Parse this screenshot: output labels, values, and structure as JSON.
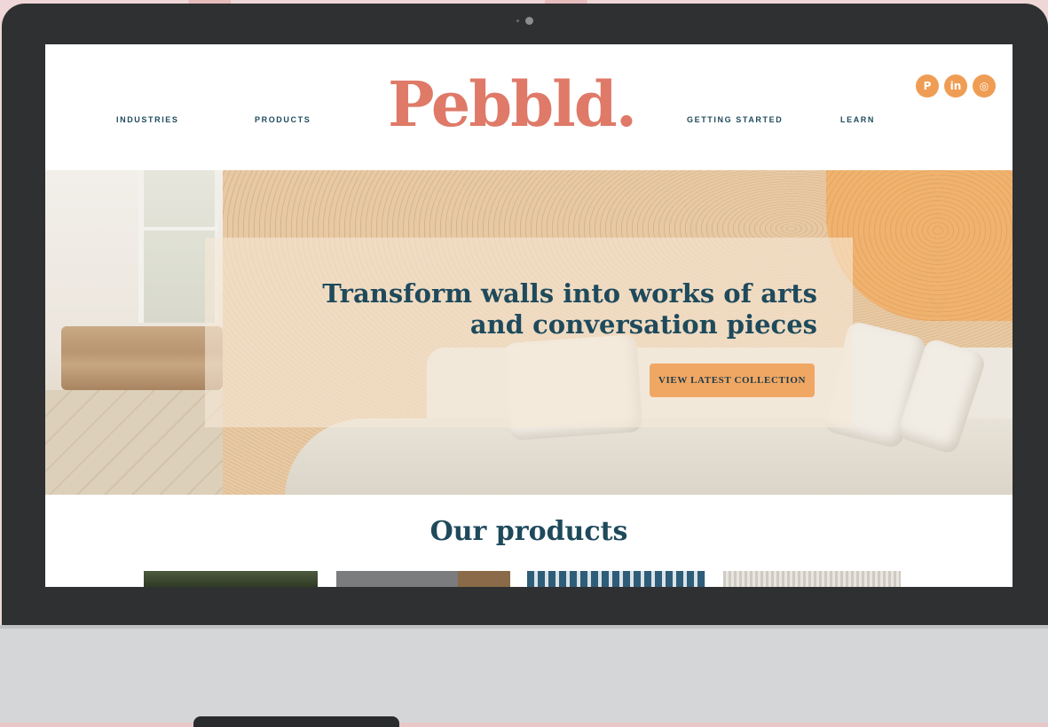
{
  "brand": {
    "logo": "Pebbld.",
    "accent_color": "#df7a68",
    "primary_text_color": "#1e4a5c",
    "button_color": "#f0a763"
  },
  "nav": {
    "left": [
      "INDUSTRIES",
      "PRODUCTS"
    ],
    "right": [
      "GETTING STARTED",
      "LEARN"
    ]
  },
  "social": [
    {
      "icon": "pinterest-icon",
      "glyph": "P"
    },
    {
      "icon": "linkedin-icon",
      "glyph": "in"
    },
    {
      "icon": "instagram-icon",
      "glyph": "◎"
    }
  ],
  "hero": {
    "title_line1": "Transform walls into works of arts",
    "title_line2": "and conversation pieces",
    "cta": "VIEW LATEST COLLECTION"
  },
  "products": {
    "title": "Our products"
  }
}
